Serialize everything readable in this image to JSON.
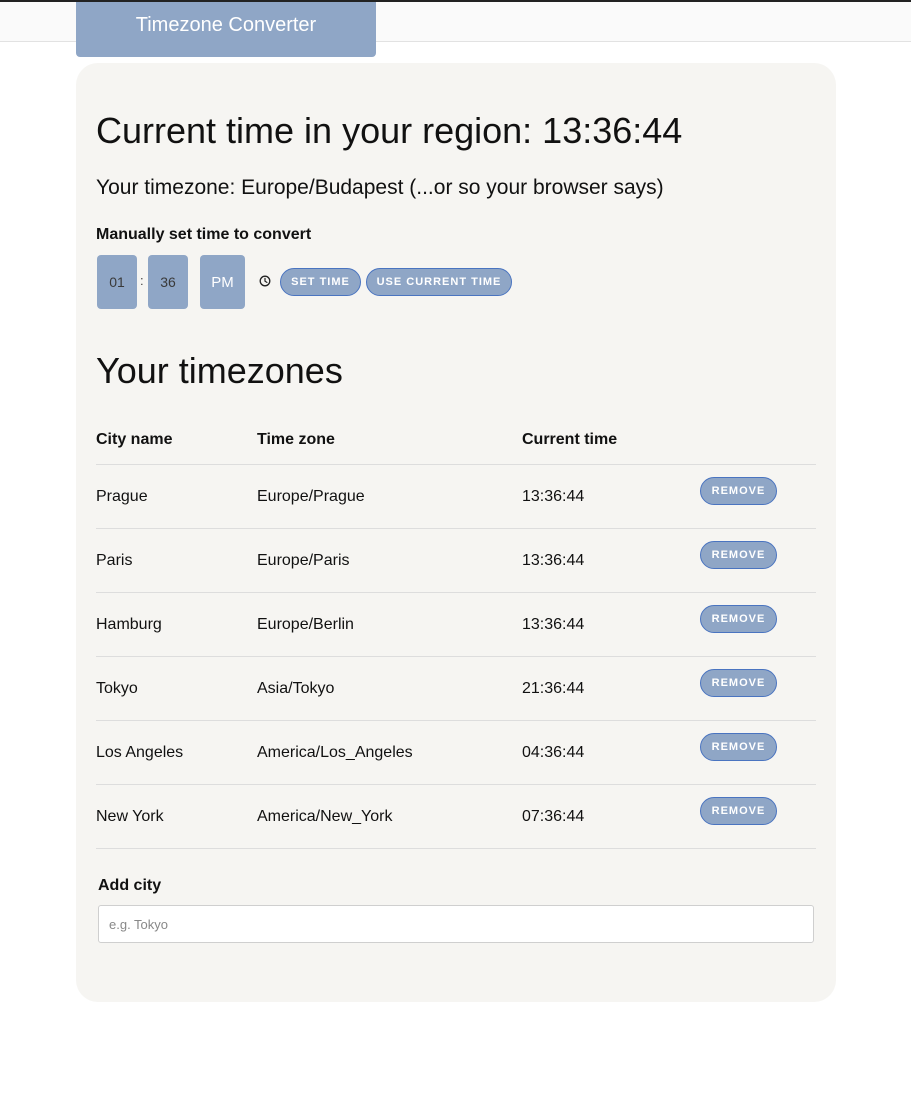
{
  "app": {
    "title": "Timezone Converter"
  },
  "header": {
    "current_time_label": "Current time in your region: 13:36:44",
    "timezone_line": "Your timezone: Europe/Budapest (...or so your browser says)"
  },
  "manual": {
    "label": "Manually set time to convert",
    "hour": "01",
    "separator": ":",
    "minute": "36",
    "ampm": "PM",
    "clock_icon": "clock-icon",
    "set_time_label": "Set time",
    "use_current_label": "Use current time"
  },
  "timezones": {
    "title": "Your timezones",
    "columns": [
      "City name",
      "Time zone",
      "Current time"
    ],
    "remove_label": "Remove",
    "rows": [
      {
        "city": "Prague",
        "zone": "Europe/Prague",
        "time": "13:36:44"
      },
      {
        "city": "Paris",
        "zone": "Europe/Paris",
        "time": "13:36:44"
      },
      {
        "city": "Hamburg",
        "zone": "Europe/Berlin",
        "time": "13:36:44"
      },
      {
        "city": "Tokyo",
        "zone": "Asia/Tokyo",
        "time": "21:36:44"
      },
      {
        "city": "Los Angeles",
        "zone": "America/Los_Angeles",
        "time": "04:36:44"
      },
      {
        "city": "New York",
        "zone": "America/New_York",
        "time": "07:36:44"
      }
    ]
  },
  "add_city": {
    "label": "Add city",
    "placeholder": "e.g. Tokyo",
    "value": ""
  },
  "colors": {
    "accent": "#8fa6c6",
    "accent_border": "#4a74c0",
    "card_background": "#f6f5f2"
  }
}
